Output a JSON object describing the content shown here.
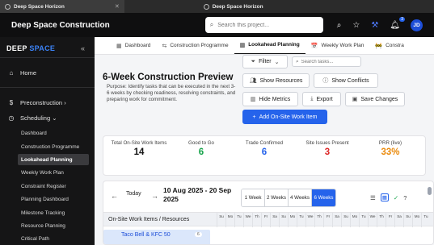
{
  "browser": {
    "tabs": [
      {
        "title": "Deep Space Horizon",
        "close": "✕"
      },
      {
        "title": "Deep Space Horizon"
      }
    ]
  },
  "header": {
    "app_name": "Deep Space Construction",
    "search_placeholder": "Search this project...",
    "notification_count": "3",
    "avatar_initials": "JD",
    "icons": [
      "search-icon",
      "star-icon",
      "hammer-icon",
      "bell-icon"
    ]
  },
  "sidebar": {
    "brand_part1": "DEEP",
    "brand_part2": "SPACE",
    "collapse": "«",
    "home": "Home",
    "preconstruction": "Preconstruction ›",
    "scheduling": "Scheduling ⌄",
    "items": [
      "Dashboard",
      "Construction Programme",
      "Lookahead Planning",
      "Weekly Work Plan",
      "Constraint Register",
      "Planning Dashboard",
      "Milestone Tracking",
      "Resource Planning",
      "Critical Path"
    ],
    "active_item": "Lookahead Planning"
  },
  "tabs": [
    {
      "label": "Dashboard",
      "icon": "▦"
    },
    {
      "label": "Construction Programme",
      "icon": "⇆"
    },
    {
      "label": "Lookahead Planning",
      "icon": "▥"
    },
    {
      "label": "Weekly Work Plan",
      "icon": "📅"
    },
    {
      "label": "Constra",
      "icon": "🚧"
    }
  ],
  "active_tab": "Lookahead Planning",
  "toolbar": {
    "filter": "Filter",
    "filter_caret": "⌄",
    "search_placeholder": "Search tasks...",
    "show_resources": "Show Resources",
    "show_conflicts": "Show Conflicts",
    "hide_metrics": "Hide Metrics",
    "export": "Export",
    "save_changes": "Save Changes",
    "add_item": "Add On-Site Work Item"
  },
  "page": {
    "title": "6-Week Construction Preview",
    "purpose": "Purpose: Identify tasks that can be executed in the next 3-6 weeks by checking readiness, resolving constraints, and preparing work for commitment."
  },
  "stats": [
    {
      "label": "Total On-Site Work Items",
      "value": "14",
      "color": "#111111"
    },
    {
      "label": "Good to Go",
      "value": "6",
      "color": "#16a34a"
    },
    {
      "label": "Trade Confirmed",
      "value": "6",
      "color": "#2563eb"
    },
    {
      "label": "Site Issues Present",
      "value": "3",
      "color": "#dc2626"
    },
    {
      "label": "PRR (live)",
      "value": "33%",
      "color": "#ea8a0c"
    }
  ],
  "calendar": {
    "prev": "←",
    "next": "→",
    "today": "Today",
    "date_range": "10 Aug 2025 - 20 Sep 2025",
    "week_options": [
      "1 Week",
      "2 Weeks",
      "4 Weeks",
      "6 Weeks"
    ],
    "active_week": "6 Weeks",
    "column_header": "On-Site Work Items / Resources",
    "day_headers": [
      "Su",
      "Mo",
      "Tu",
      "We",
      "Th",
      "Fr",
      "Sa",
      "Su",
      "Mo",
      "Tu",
      "We",
      "Th",
      "Fr",
      "Sa",
      "Su",
      "Mo",
      "Tu",
      "We",
      "Th",
      "Fr",
      "Sa",
      "Su",
      "Mo",
      "Tu"
    ],
    "first_row": {
      "label": "Taco Bell & KFC 50",
      "badge": "6"
    }
  },
  "colors": {
    "accent": "#2563eb",
    "sidebar_bg": "#151516",
    "header_bg": "#0f0f10"
  }
}
